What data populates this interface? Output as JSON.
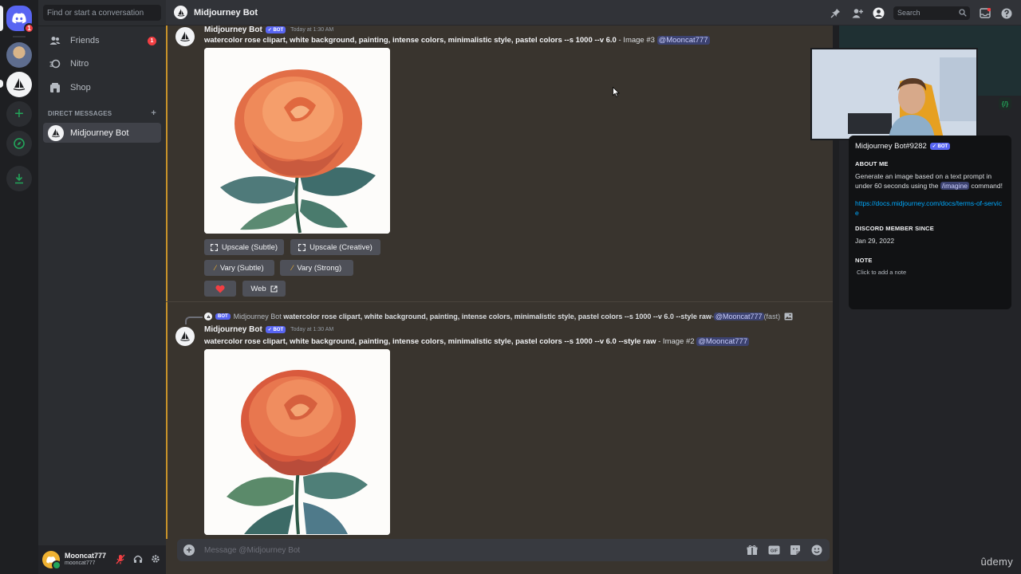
{
  "colors": {
    "blurple": "#5865f2",
    "green": "#23a55a",
    "red": "#f23f43",
    "accent_bar": "#c8922a",
    "link": "#00a8fc"
  },
  "rail": {
    "home_badge": "1",
    "icons": [
      "discord-logo-icon",
      "plus-icon",
      "compass-icon",
      "download-icon"
    ]
  },
  "sidebar": {
    "search_placeholder": "Find or start a conversation",
    "nav": [
      {
        "label": "Friends",
        "icon": "friends-icon",
        "badge": "1"
      },
      {
        "label": "Nitro",
        "icon": "nitro-icon"
      },
      {
        "label": "Shop",
        "icon": "shop-icon"
      }
    ],
    "dm_header": "DIRECT MESSAGES",
    "dm_add": "+",
    "dms": [
      {
        "name": "Midjourney Bot"
      }
    ],
    "user": {
      "name": "Mooncat777",
      "tag": "mooncat777"
    }
  },
  "header": {
    "title": "Midjourney Bot",
    "search_placeholder": "Search",
    "icons": [
      "pin-icon",
      "add-friend-icon",
      "profile-toggle-icon",
      "inbox-icon",
      "help-icon"
    ]
  },
  "messages": [
    {
      "author": "Midjourney Bot",
      "bot_tag": "✓ BOT",
      "timestamp": "Today at 1:30 AM",
      "prompt": "watercolor rose clipart, white background, painting, intense colors, minimalistic style, pastel colors --s 1000 --v 6.0",
      "suffix": " - Image #3 ",
      "mention": "@Mooncat777",
      "buttons": {
        "upscale_subtle": "Upscale (Subtle)",
        "upscale_creative": "Upscale (Creative)",
        "vary_subtle": "Vary (Subtle)",
        "vary_strong": "Vary (Strong)",
        "web": "Web"
      }
    },
    {
      "reply": {
        "bot_tag": "BOT",
        "author": "Midjourney Bot",
        "prompt": "watercolor rose clipart, white background, painting, intense colors, minimalistic style, pastel colors --s 1000 --v 6.0 --style raw",
        "dash": " - ",
        "mention": "@Mooncat777",
        "speed": " (fast)"
      },
      "author": "Midjourney Bot",
      "bot_tag": "✓ BOT",
      "timestamp": "Today at 1:30 AM",
      "prompt": "watercolor rose clipart, white background, painting, intense colors, minimalistic style, pastel colors --s 1000 --v 6.0 --style raw",
      "suffix": " - Image #2 ",
      "mention": "@Mooncat777"
    }
  ],
  "composer": {
    "placeholder": "Message @Midjourney Bot",
    "icons": [
      "gift-icon",
      "gif-icon",
      "sticker-icon",
      "emoji-icon"
    ]
  },
  "profile": {
    "name": "Midjourney Bot#9282",
    "bot_tag": "✓ BOT",
    "about_header": "ABOUT ME",
    "about_pre": "Generate an image based on a text prompt in under 60 seconds using the ",
    "about_cmd": "/imagine",
    "about_post": " command!",
    "link": "https://docs.midjourney.com/docs/terms-of-service",
    "member_header": "DISCORD MEMBER SINCE",
    "member_since": "Jan 29, 2022",
    "note_header": "NOTE",
    "note_placeholder": "Click to add a note",
    "json_badge": "{/}"
  },
  "watermark": "ûdemy"
}
